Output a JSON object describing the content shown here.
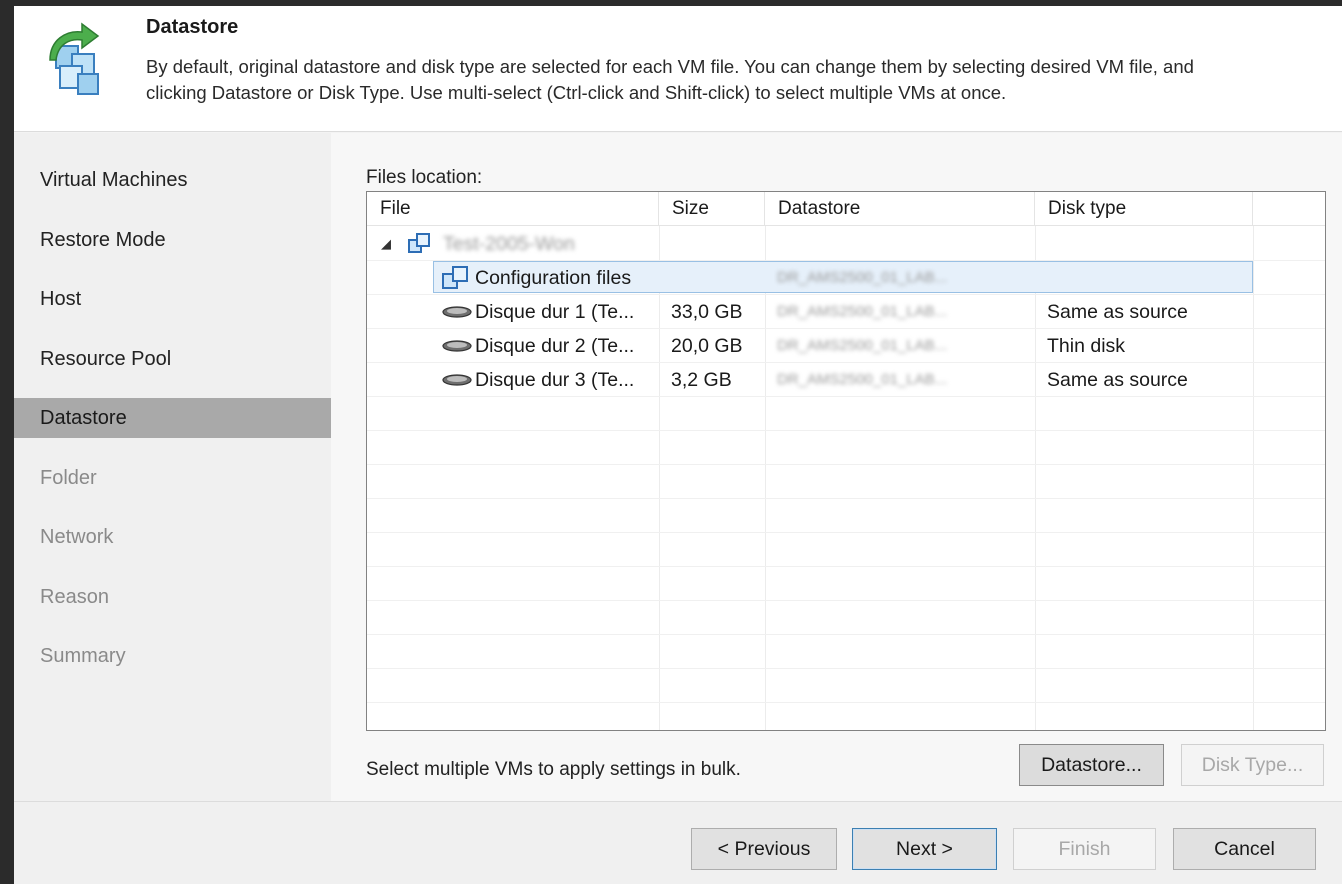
{
  "header": {
    "title": "Datastore",
    "description": "By default, original datastore and disk type are selected for each VM file. You can change them by selecting desired VM file, and\nclicking Datastore or Disk Type. Use multi-select (Ctrl-click and Shift-click) to select multiple VMs at once.",
    "icon": "vm-restore-icon"
  },
  "steps": [
    {
      "label": "Virtual Machines",
      "state": "done"
    },
    {
      "label": "Restore Mode",
      "state": "done"
    },
    {
      "label": "Host",
      "state": "done"
    },
    {
      "label": "Resource Pool",
      "state": "done"
    },
    {
      "label": "Datastore",
      "state": "current"
    },
    {
      "label": "Folder",
      "state": "pending"
    },
    {
      "label": "Network",
      "state": "pending"
    },
    {
      "label": "Reason",
      "state": "pending"
    },
    {
      "label": "Summary",
      "state": "pending"
    }
  ],
  "files": {
    "label": "Files location:",
    "columns": [
      "File",
      "Size",
      "Datastore",
      "Disk type"
    ],
    "vm_name": "Test-2005-Won",
    "rows": [
      {
        "file": "Configuration files",
        "size": "",
        "datastore": "DR_AMS2500_01_LAB...",
        "disk_type": "",
        "icon": "vm-files-icon",
        "selected": true
      },
      {
        "file": "Disque dur 1 (Te...",
        "size": "33,0 GB",
        "datastore": "DR_AMS2500_01_LAB...",
        "disk_type": "Same as source",
        "icon": "hard-disk-icon",
        "selected": false
      },
      {
        "file": "Disque dur 2 (Te...",
        "size": "20,0 GB",
        "datastore": "DR_AMS2500_01_LAB...",
        "disk_type": "Thin disk",
        "icon": "hard-disk-icon",
        "selected": false
      },
      {
        "file": "Disque dur 3 (Te...",
        "size": "3,2 GB",
        "datastore": "DR_AMS2500_01_LAB...",
        "disk_type": "Same as source",
        "icon": "hard-disk-icon",
        "selected": false
      }
    ]
  },
  "bulk_hint": "Select multiple VMs to apply settings in bulk.",
  "buttons": {
    "datastore": "Datastore...",
    "disk_type": "Disk Type...",
    "previous": "< Previous",
    "next": "Next >",
    "finish": "Finish",
    "cancel": "Cancel"
  }
}
